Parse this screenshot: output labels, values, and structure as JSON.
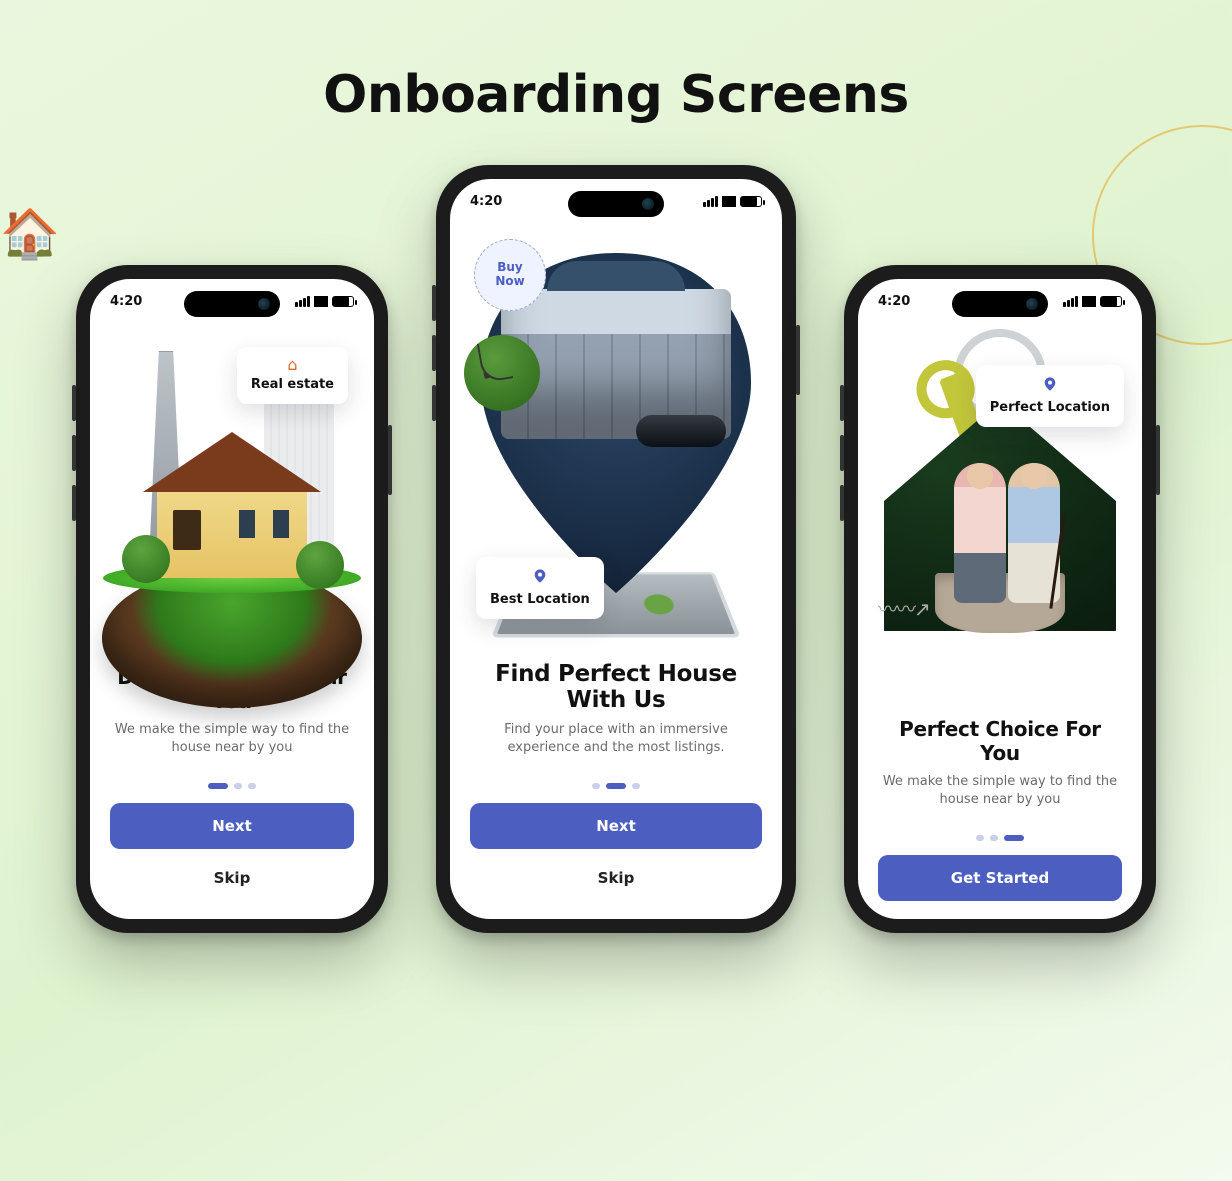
{
  "page_title": "Onboarding Screens",
  "status_time": "4:20",
  "colors": {
    "primary": "#4c5fc1"
  },
  "screens": [
    {
      "chip": {
        "icon_name": "house-icon",
        "label": "Real estate",
        "style": "card",
        "pos": "tr"
      },
      "heading": "Discover House Near You",
      "body": "We make the simple way to find the house near by you",
      "active_dot": 0,
      "primary_cta": "Next",
      "secondary_cta": "Skip"
    },
    {
      "bubble": {
        "label": "Buy\nNow"
      },
      "chip": {
        "icon_name": "pin-icon",
        "label": "Best Location",
        "style": "card",
        "pos": "bl"
      },
      "heading": "Find Perfect House With Us",
      "body": "Find your place with an immersive experience and the most listings.",
      "active_dot": 1,
      "primary_cta": "Next",
      "secondary_cta": "Skip"
    },
    {
      "chip": {
        "icon_name": "pin-icon",
        "label": "Perfect Location",
        "style": "card",
        "pos": "tr"
      },
      "heading": "Perfect Choice For You",
      "body": "We make the simple way to find the house near by you",
      "active_dot": 2,
      "primary_cta": "Get Started",
      "secondary_cta": null
    }
  ]
}
